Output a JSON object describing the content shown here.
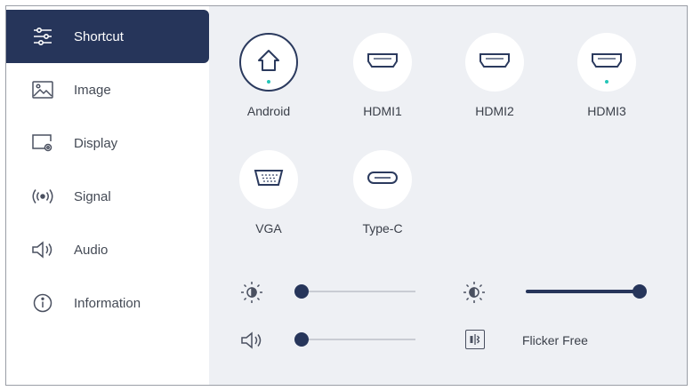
{
  "sidebar": {
    "items": [
      {
        "label": "Shortcut",
        "icon": "sliders-icon",
        "active": true
      },
      {
        "label": "Image",
        "icon": "image-icon",
        "active": false
      },
      {
        "label": "Display",
        "icon": "display-settings-icon",
        "active": false
      },
      {
        "label": "Signal",
        "icon": "signal-icon",
        "active": false
      },
      {
        "label": "Audio",
        "icon": "speaker-icon",
        "active": false
      },
      {
        "label": "Information",
        "icon": "info-icon",
        "active": false
      }
    ]
  },
  "sources": [
    {
      "label": "Android",
      "icon": "home-icon",
      "selected": true,
      "indicator": true
    },
    {
      "label": "HDMI1",
      "icon": "hdmi-icon",
      "selected": false,
      "indicator": false
    },
    {
      "label": "HDMI2",
      "icon": "hdmi-icon",
      "selected": false,
      "indicator": false
    },
    {
      "label": "HDMI3",
      "icon": "hdmi-icon",
      "selected": false,
      "indicator": true
    },
    {
      "label": "VGA",
      "icon": "vga-icon",
      "selected": false,
      "indicator": false
    },
    {
      "label": "Type-C",
      "icon": "usb-c-icon",
      "selected": false,
      "indicator": false
    }
  ],
  "controls": {
    "brightness": {
      "icon": "brightness-icon",
      "level": 0
    },
    "contrast": {
      "icon": "contrast-icon",
      "level": 1
    },
    "volume": {
      "icon": "volume-icon",
      "level": 0
    },
    "flicker_free": {
      "icon": "flicker-free-icon",
      "label": "Flicker Free"
    }
  },
  "colors": {
    "accent": "#26355a",
    "indicator": "#23c5b7",
    "panel": "#eef0f4"
  }
}
